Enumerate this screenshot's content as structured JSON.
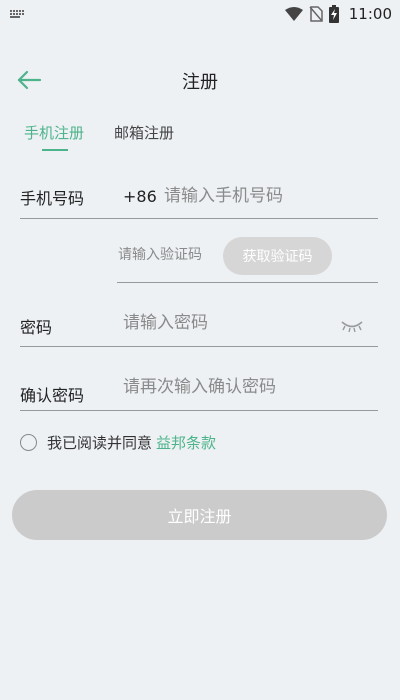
{
  "status_bar": {
    "time": "11:00",
    "icons": [
      "keyboard-icon",
      "wifi-icon",
      "no-sim-icon",
      "battery-charging-icon"
    ]
  },
  "header": {
    "title": "注册",
    "back_icon": "arrow-left-icon"
  },
  "tabs": [
    {
      "label": "手机注册",
      "active": true
    },
    {
      "label": "邮箱注册",
      "active": false
    }
  ],
  "form": {
    "phone": {
      "label": "手机号码",
      "prefix": "+86",
      "placeholder": "请输入手机号码",
      "value": ""
    },
    "code": {
      "placeholder": "请输入验证码",
      "value": "",
      "button_label": "获取验证码"
    },
    "password": {
      "label": "密码",
      "placeholder": "请输入密码",
      "value": "",
      "toggle_icon": "eye-closed-icon"
    },
    "confirm": {
      "label": "确认密码",
      "placeholder": "请再次输入确认密码",
      "value": ""
    }
  },
  "agreement": {
    "text": "我已阅读并同意",
    "link": "益邦条款",
    "checked": false
  },
  "submit": {
    "label": "立即注册"
  },
  "colors": {
    "accent": "#4db38a",
    "background": "#edf1f4",
    "disabled_button": "#cbcbcb"
  }
}
